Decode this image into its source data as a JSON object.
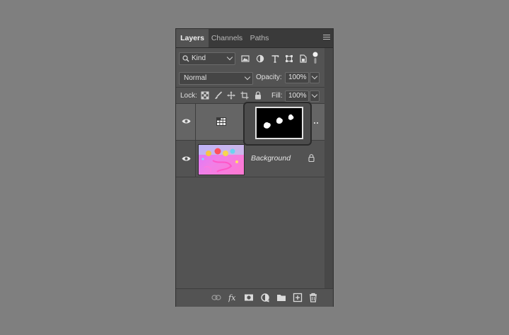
{
  "panel": {
    "tabs": [
      {
        "label": "Layers",
        "active": true
      },
      {
        "label": "Channels",
        "active": false
      },
      {
        "label": "Paths",
        "active": false
      }
    ],
    "menu_icon": "hamburger-menu-icon"
  },
  "filter": {
    "kind_label": "Kind",
    "icons": [
      "pixel-layer-filter-icon",
      "adjustment-layer-filter-icon",
      "type-layer-filter-icon",
      "shape-layer-filter-icon",
      "smart-object-filter-icon",
      "filter-toggle-icon"
    ]
  },
  "blend": {
    "mode": "Normal",
    "opacity_label": "Opacity:",
    "opacity_value": "100%"
  },
  "lock": {
    "label": "Lock:",
    "icons": [
      "lock-transparent-pixels-icon",
      "lock-image-pixels-icon",
      "lock-position-icon",
      "lock-artboard-icon",
      "lock-all-icon"
    ],
    "fill_label": "Fill:",
    "fill_value": "100%"
  },
  "layers": [
    {
      "name": "",
      "type": "adjustment",
      "selected": true,
      "visible": true
    },
    {
      "name": "Background",
      "type": "image",
      "selected": false,
      "visible": true,
      "locked": true
    }
  ],
  "footer_icons": [
    "link-layers-icon",
    "fx-icon",
    "add-mask-icon",
    "adjustment-layer-icon",
    "group-folder-icon",
    "new-layer-icon",
    "trash-icon"
  ],
  "colors": {
    "background": "#7f7f7f",
    "panel": "#535353",
    "selected_row": "#656565"
  }
}
